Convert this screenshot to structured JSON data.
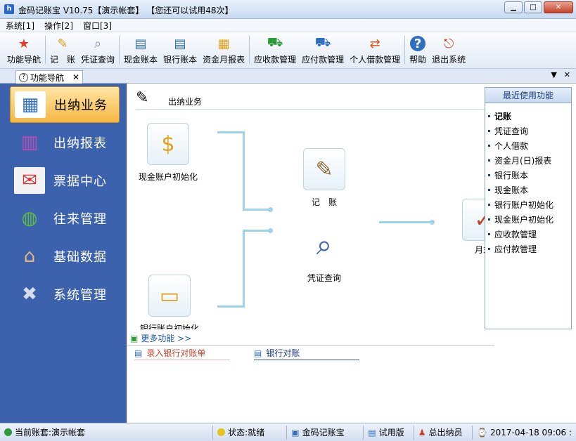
{
  "window": {
    "title": "金码记账宝  V10.75【演示帐套】 【您还可以试用48次】",
    "controls": {
      "minimize": "▁",
      "maximize": "□",
      "close": "✕"
    }
  },
  "menu": [
    "系统[1]",
    "操作[2]",
    "窗口[3]"
  ],
  "toolbar": [
    {
      "label": "功能导航",
      "icon": "★"
    },
    {
      "label": "记　账",
      "icon": "✎"
    },
    {
      "label": "凭证查询",
      "icon": "⌕"
    },
    {
      "label": "现金账本",
      "icon": "▤"
    },
    {
      "label": "银行账本",
      "icon": "▤"
    },
    {
      "label": "资金月报表",
      "icon": "▦"
    },
    {
      "label": "应收款管理",
      "icon": "⛟"
    },
    {
      "label": "应付款管理",
      "icon": "⛟"
    },
    {
      "label": "个人借款管理",
      "icon": "⇄"
    },
    {
      "label": "帮助",
      "icon": "?"
    },
    {
      "label": "退出系统",
      "icon": "⎋"
    }
  ],
  "tab": {
    "label": "功能导航",
    "close": "✕",
    "dropdown": "▼",
    "close_all": "✕"
  },
  "sidebar": [
    {
      "label": "出纳业务",
      "icon": "▦",
      "active": true
    },
    {
      "label": "出纳报表",
      "icon": "▥"
    },
    {
      "label": "票据中心",
      "icon": "✉"
    },
    {
      "label": "往来管理",
      "icon": "◍"
    },
    {
      "label": "基础数据",
      "icon": "⌂"
    },
    {
      "label": "系统管理",
      "icon": "✖"
    }
  ],
  "content": {
    "header": "出纳业务",
    "nodes": {
      "cash_init": "现金账户初始化",
      "bookkeeping": "记　账",
      "voucher_query": "凭证查询",
      "bank_init": "银行账户初始化",
      "month_end": "月末"
    }
  },
  "recent": {
    "title": "最近使用功能",
    "items": [
      "记账",
      "凭证查询",
      "个人借款",
      "资金月(日)报表",
      "银行账本",
      "现金账本",
      "银行账户初始化",
      "现金账户初始化",
      "应收款管理",
      "应付款管理"
    ]
  },
  "more": {
    "title": "更多功能 >>",
    "items": [
      "录入银行对账单",
      "银行对账"
    ]
  },
  "status": {
    "account": "当前账套:演示帐套",
    "state": "状态:就绪",
    "product": "金码记账宝",
    "edition": "试用版",
    "user": "总出纳员",
    "datetime": "2017-04-18 09:06 :"
  },
  "colors": {
    "sidebar": "#3d62ad",
    "active_nav": "#f7b743",
    "connector": "#9fd3ec"
  }
}
